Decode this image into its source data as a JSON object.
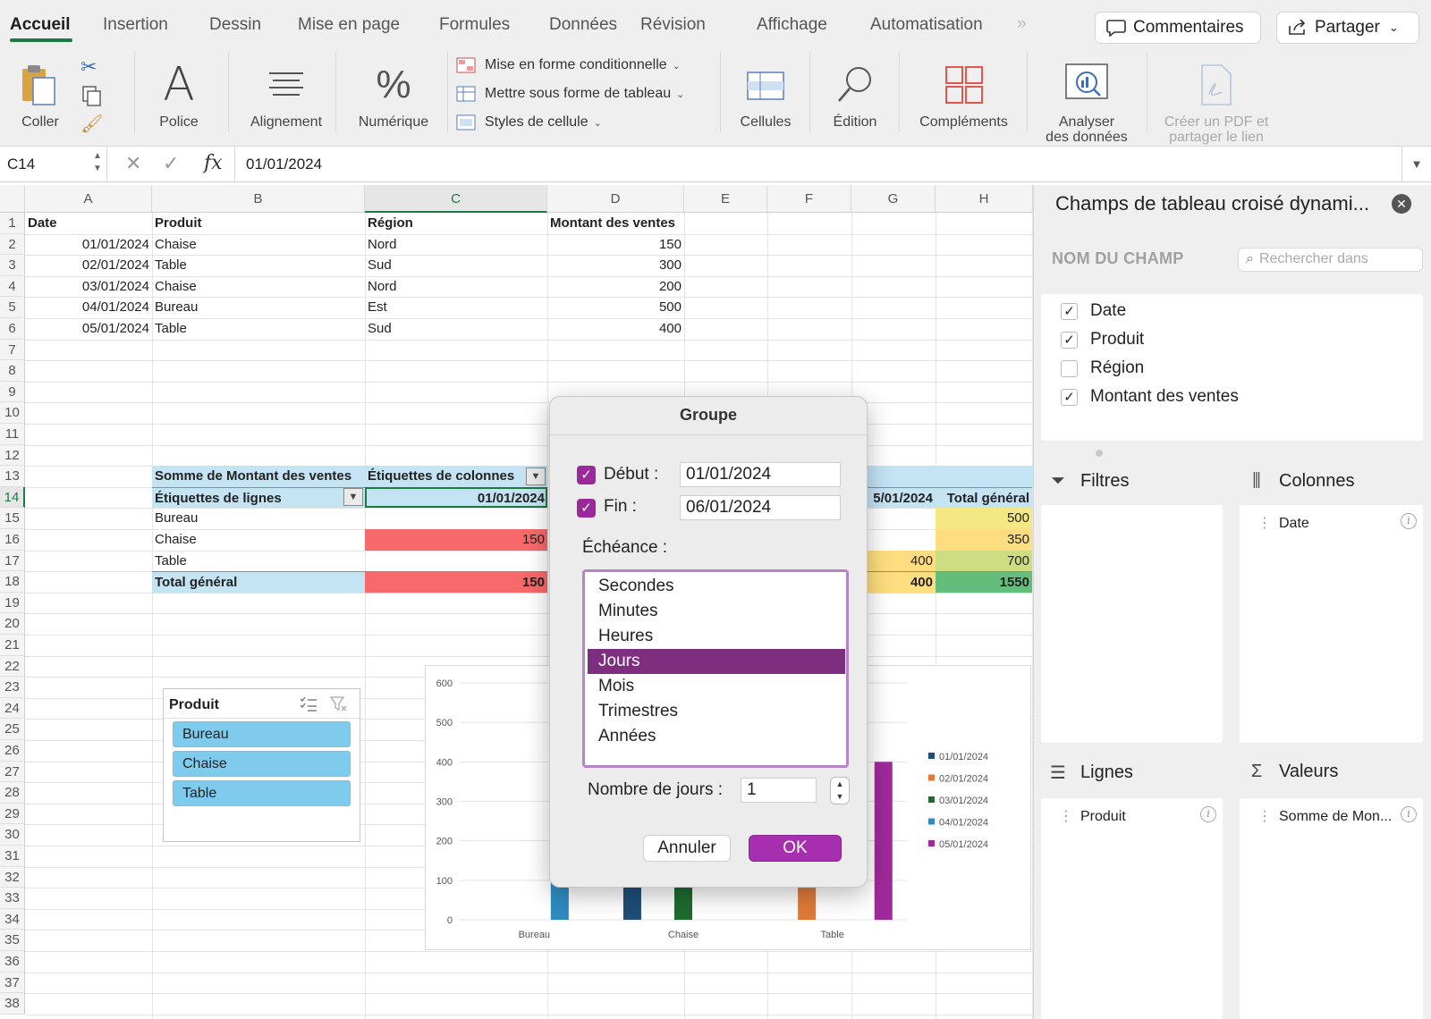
{
  "ribbon_tabs": {
    "items": [
      "Accueil",
      "Insertion",
      "Dessin",
      "Mise en page",
      "Formules",
      "Données",
      "Révision",
      "Affichage",
      "Automatisation"
    ],
    "more": "»"
  },
  "header_buttons": {
    "comments": "Commentaires",
    "share": "Partager"
  },
  "ribbon": {
    "coller": "Coller",
    "police": "Police",
    "alignement": "Alignement",
    "numerique": "Numérique",
    "styles": [
      "Mise en forme conditionnelle",
      "Mettre sous forme de tableau",
      "Styles de cellule"
    ],
    "cellules": "Cellules",
    "edition": "Édition",
    "complements": "Compléments",
    "analyser_1": "Analyser",
    "analyser_2": "des données",
    "pdf_1": "Créer un PDF et",
    "pdf_2": "partager le lien"
  },
  "formula_bar": {
    "name_box": "C14",
    "fx": "fx",
    "value": "01/01/2024"
  },
  "sheet": {
    "columns": [
      "A",
      "B",
      "C",
      "D",
      "E",
      "F",
      "G",
      "H"
    ],
    "selected_column": "C",
    "selected_row": 14,
    "row_numbers": [
      "1",
      "2",
      "3",
      "4",
      "5",
      "6",
      "7",
      "8",
      "9",
      "10",
      "11",
      "12",
      "13",
      "14",
      "15",
      "16",
      "17",
      "18",
      "19",
      "20",
      "21",
      "22",
      "23",
      "24",
      "25",
      "26",
      "27",
      "28",
      "29",
      "30",
      "31",
      "32",
      "33",
      "34",
      "35",
      "36",
      "37",
      "38"
    ],
    "data_headers": [
      "Date",
      "Produit",
      "Région",
      "Montant des ventes"
    ],
    "data_rows": [
      [
        "01/01/2024",
        "Chaise",
        "Nord",
        "150"
      ],
      [
        "02/01/2024",
        "Table",
        "Sud",
        "300"
      ],
      [
        "03/01/2024",
        "Chaise",
        "Nord",
        "200"
      ],
      [
        "04/01/2024",
        "Bureau",
        "Est",
        "500"
      ],
      [
        "05/01/2024",
        "Table",
        "Sud",
        "400"
      ]
    ]
  },
  "pivot": {
    "values_label": "Somme de Montant des ventes",
    "col_labels": "Étiquettes de colonnes",
    "row_labels": "Étiquettes de lignes",
    "first_date": "01/01/2024",
    "last_date_partial": "5/01/2024",
    "grand_total_header": "Total général",
    "rows": [
      {
        "label": "Bureau",
        "c": "",
        "g": "",
        "h": "500"
      },
      {
        "label": "Chaise",
        "c": "150",
        "g": "",
        "h": "350"
      },
      {
        "label": "Table",
        "c": "",
        "g": "400",
        "h": "700"
      }
    ],
    "total": {
      "label": "Total général",
      "c": "150",
      "g": "400",
      "h": "1550"
    },
    "colors": {
      "red": "#f8696b",
      "yellow": "#fedd81",
      "pale_yellow": "#f3e884",
      "yellow_green": "#cedd82",
      "green": "#63be7b",
      "header_blue": "#c4e3f3"
    }
  },
  "slicer": {
    "title": "Produit",
    "items": [
      "Bureau",
      "Chaise",
      "Table"
    ]
  },
  "chart_data": {
    "type": "bar",
    "categories": [
      "Bureau",
      "Chaise",
      "Table"
    ],
    "series": [
      {
        "name": "01/01/2024",
        "color": "#1f4e79",
        "values": [
          0,
          150,
          0
        ]
      },
      {
        "name": "02/01/2024",
        "color": "#e07b39",
        "values": [
          0,
          0,
          300
        ]
      },
      {
        "name": "03/01/2024",
        "color": "#1e6b2e",
        "values": [
          0,
          200,
          0
        ]
      },
      {
        "name": "04/01/2024",
        "color": "#2e8bc0",
        "values": [
          500,
          0,
          0
        ]
      },
      {
        "name": "05/01/2024",
        "color": "#a0299a",
        "values": [
          0,
          0,
          400
        ]
      }
    ],
    "yticks": [
      "0",
      "100",
      "200",
      "300",
      "400",
      "500",
      "600"
    ],
    "ylim": [
      0,
      600
    ],
    "legend": "right",
    "partially_hidden_by_dialog": true
  },
  "dialog": {
    "title": "Groupe",
    "start_label": "Début :",
    "start_value": "01/01/2024",
    "end_label": "Fin :",
    "end_value": "06/01/2024",
    "interval_label": "Échéance :",
    "intervals": [
      "Secondes",
      "Minutes",
      "Heures",
      "Jours",
      "Mois",
      "Trimestres",
      "Années"
    ],
    "selected_interval": "Jours",
    "days_label": "Nombre de jours :",
    "days_value": "1",
    "cancel": "Annuler",
    "ok": "OK"
  },
  "pivot_panel": {
    "title": "Champs de tableau croisé dynami...",
    "field_name_header": "NOM DU CHAMP",
    "search_placeholder": "Rechercher dans",
    "fields": [
      {
        "name": "Date",
        "checked": true
      },
      {
        "name": "Produit",
        "checked": true
      },
      {
        "name": "Région",
        "checked": false
      },
      {
        "name": "Montant des ventes",
        "checked": true
      }
    ],
    "filters": "Filtres",
    "columns": "Colonnes",
    "columns_item": "Date",
    "rows": "Lignes",
    "rows_item": "Produit",
    "values": "Valeurs",
    "values_item": "Somme de Mon..."
  }
}
